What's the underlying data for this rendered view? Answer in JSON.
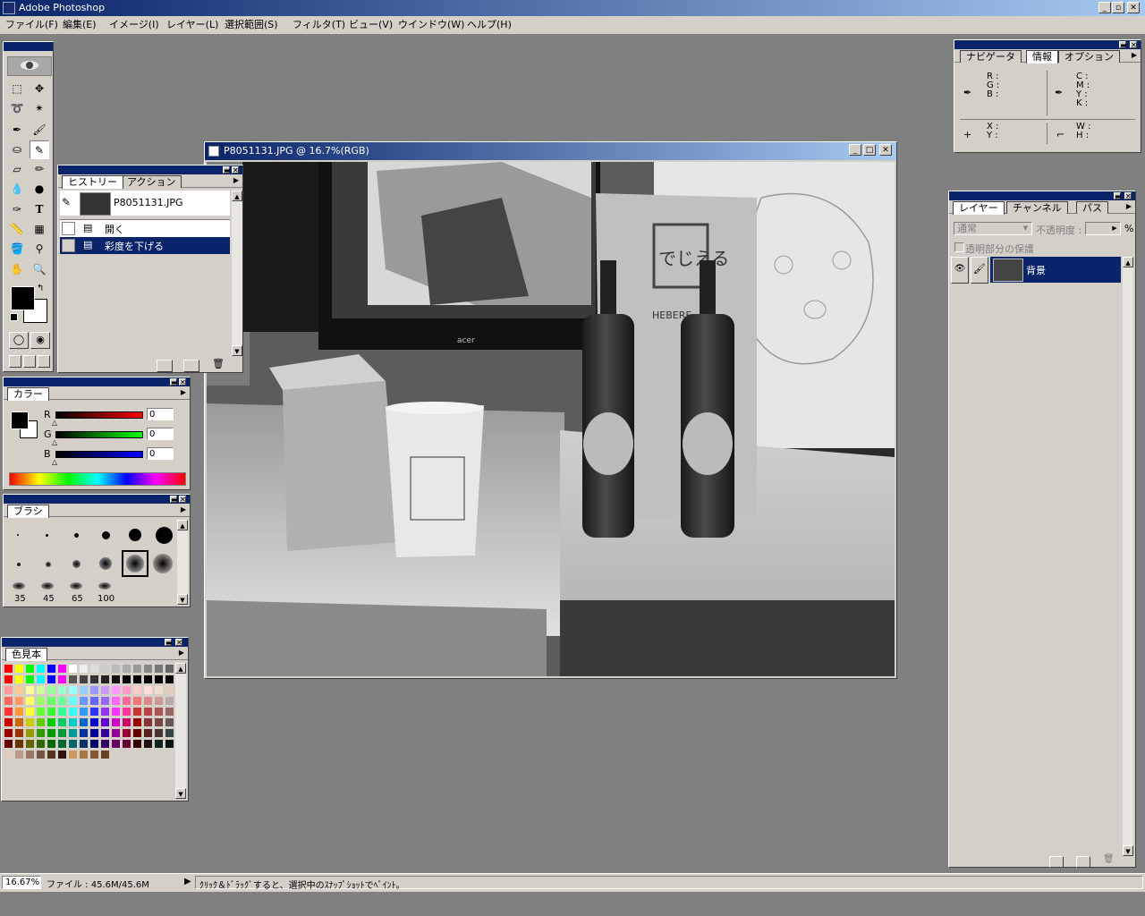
{
  "app": {
    "title": "Adobe Photoshop"
  },
  "menu": [
    "ファイル(F)",
    "編集(E)",
    "イメージ(I)",
    "レイヤー(L)",
    "選択範囲(S)",
    "フィルタ(T)",
    "ビュー(V)",
    "ウインドウ(W)",
    "ヘルプ(H)"
  ],
  "document": {
    "title": "P8051131.JPG @ 16.7%(RGB)"
  },
  "history": {
    "tabs": [
      "ヒストリー",
      "アクション"
    ],
    "snapshot": "P8051131.JPG",
    "items": [
      "開く",
      "彩度を下げる"
    ]
  },
  "color": {
    "tab": "カラー",
    "channels": [
      {
        "label": "R",
        "value": "0"
      },
      {
        "label": "G",
        "value": "0"
      },
      {
        "label": "B",
        "value": "0"
      }
    ]
  },
  "brushes": {
    "tab": "ブラシ",
    "sizes": [
      "35",
      "45",
      "65",
      "100"
    ]
  },
  "swatches": {
    "tab": "色見本"
  },
  "info": {
    "tabs": [
      "ナビゲータ",
      "情報",
      "オプション"
    ],
    "rgb": [
      "R :",
      "G :",
      "B :"
    ],
    "cmyk": [
      "C :",
      "M :",
      "Y :",
      "K :"
    ],
    "xy": [
      "X :",
      "Y :"
    ],
    "wh": [
      "W :",
      "H :"
    ]
  },
  "layers": {
    "tabs": [
      "レイヤー",
      "チャンネル",
      "パス"
    ],
    "mode": "通常",
    "opacity_label": "不透明度 :",
    "opacity_unit": "%",
    "preserve": "透明部分の保護",
    "layer_name": "背景"
  },
  "status": {
    "zoom": "16.67%",
    "file": "ファイル : 45.6M/45.6M",
    "hint": "ｸﾘｯｸ＆ﾄﾞﾗｯｸﾞすると、選択中のｽﾅｯﾌﾟｼｮｯﾄでﾍﾟｲﾝﾄ。"
  },
  "photo": {
    "box_text": "でじえる",
    "box_brand": "HEBERE",
    "monitor_brand": "acer"
  },
  "colors": {
    "title_active": "#0a246a",
    "title_fade": "#a6caf0",
    "face": "#d4d0c8",
    "workspace": "#808080"
  }
}
